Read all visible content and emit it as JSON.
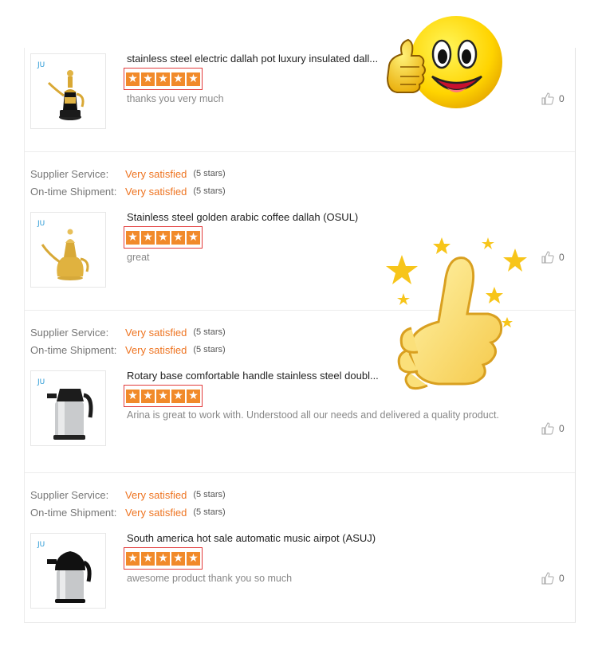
{
  "labels": {
    "supplier_service": "Supplier Service:",
    "ontime_shipment": "On-time Shipment:"
  },
  "colors": {
    "accent_orange": "#ee7421",
    "star_fill": "#f18a2a",
    "star_box_border": "#e23b3b"
  },
  "reviews": [
    {
      "supplier_service": null,
      "ontime_shipment": null,
      "product_title": "stainless steel electric dallah pot luxury insulated dall...",
      "product_image": "gold-electric-dallah-pot",
      "rating": 5,
      "comment": "thanks you very much",
      "likes": "0"
    },
    {
      "supplier_service": {
        "value": "Very satisfied",
        "stars": "(5 stars)"
      },
      "ontime_shipment": {
        "value": "Very satisfied",
        "stars": "(5 stars)"
      },
      "product_title": "Stainless steel golden arabic coffee dallah (OSUL)",
      "product_image": "golden-arabic-dallah",
      "rating": 5,
      "comment": "great",
      "likes": "0"
    },
    {
      "supplier_service": {
        "value": "Very satisfied",
        "stars": "(5 stars)"
      },
      "ontime_shipment": {
        "value": "Very satisfied",
        "stars": "(5 stars)"
      },
      "product_title": "Rotary base comfortable handle stainless steel doubl...",
      "product_image": "silver-airpot",
      "rating": 5,
      "comment": "Arina is great to work with. Understood all our needs and delivered a quality product.",
      "likes": "0"
    },
    {
      "supplier_service": {
        "value": "Very satisfied",
        "stars": "(5 stars)"
      },
      "ontime_shipment": {
        "value": "Very satisfied",
        "stars": "(5 stars)"
      },
      "product_title": "South america hot sale automatic music airpot (ASUJ)",
      "product_image": "black-silver-airpot",
      "rating": 5,
      "comment": "awesome product thank you so much",
      "likes": "0"
    }
  ],
  "icons": {
    "like": "thumbs-up-icon",
    "rating_star": "star-icon",
    "sticker_top": "smiley-thumbs-up",
    "sticker_middle": "thumbs-up-with-stars"
  }
}
